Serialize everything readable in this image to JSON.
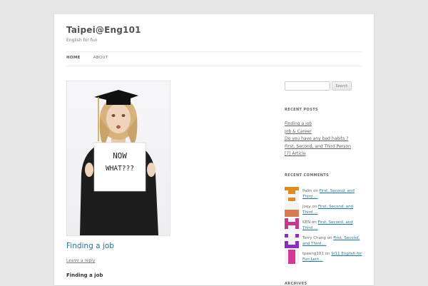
{
  "site": {
    "title": "Taipei@Eng101",
    "description": "English for fun"
  },
  "nav": {
    "items": [
      {
        "label": "HOME"
      },
      {
        "label": "ABOUT"
      }
    ]
  },
  "post": {
    "sign_text_line1": "NOW",
    "sign_text_line2": "WHAT???",
    "title": "Finding a job",
    "reply_label": "Leave a reply",
    "entry_title": "Finding a job"
  },
  "search": {
    "placeholder": "",
    "button_label": "Search"
  },
  "recent_posts": {
    "title": "RECENT POSTS",
    "items": [
      "Finding a job",
      "Job & Career",
      "Do you have any bad habits ?",
      "First, Second, and Third Person",
      "[7] Article"
    ]
  },
  "recent_comments": {
    "title": "RECENT COMMENTS",
    "on_word": "on",
    "items": [
      {
        "author": "Palm",
        "link": "First, Second, and Third …",
        "avatar_color": "#e08a22"
      },
      {
        "author": "Joey",
        "link": "First, Second, and Third …",
        "avatar_color": "#d97b52"
      },
      {
        "author": "KEN",
        "link": "First, Second, and Third …",
        "avatar_color": "#c23c8c"
      },
      {
        "author": "Terry Chang",
        "link": "First, Second, and Third …",
        "avatar_color": "#8a2ec0"
      },
      {
        "author": "tpeeng101",
        "link": "9/11 English for Fun Lect…",
        "avatar_color": "#d23a9a"
      }
    ]
  },
  "archives": {
    "title": "ARCHIVES"
  },
  "colors": {
    "link": "#21759b",
    "background": "#e6e6e6"
  }
}
